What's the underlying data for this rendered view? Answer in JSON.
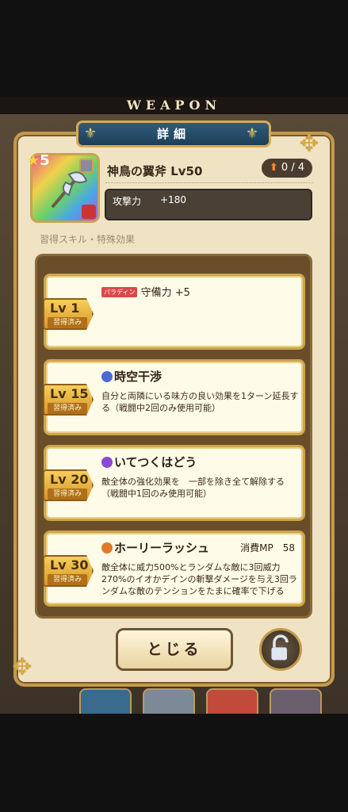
{
  "header": {
    "weapon_label": "WEAPON"
  },
  "panel": {
    "title": "詳細"
  },
  "item": {
    "stars": "5",
    "name": "神鳥の翼斧 Lv50",
    "upgrade": "0 / 4",
    "stat_label": "攻撃力",
    "stat_value": "+180"
  },
  "section_label": "習得スキル・特殊効果",
  "skills": [
    {
      "lv": "Lv 1",
      "status": "習得済み",
      "class_tag": "パラディン",
      "text": "守備力 +5"
    },
    {
      "lv": "Lv 15",
      "status": "習得済み",
      "name": "時空干渉",
      "desc": "自分と両隣にいる味方の良い効果を1ターン延長する（戦闘中2回のみ使用可能）"
    },
    {
      "lv": "Lv 20",
      "status": "習得済み",
      "name": "いてつくはどう",
      "desc": "敵全体の強化効果を　一部を除き全て解除する（戦闘中1回のみ使用可能）"
    },
    {
      "lv": "Lv 30",
      "status": "習得済み",
      "name": "ホーリーラッシュ",
      "mp": "消費MP　58",
      "desc": "敵全体に威力500%とランダムな敵に3回威力270%のイオかデインの斬撃ダメージを与え3回ランダムな敵のテンションをたまに確率で下げる"
    }
  ],
  "buttons": {
    "close": "とじる"
  },
  "colors": {
    "accent": "#c39a4c",
    "banner": "#2f5c7a",
    "badge": "#f6cf5b"
  },
  "icons": [
    "axe-icon",
    "lock-icon"
  ]
}
